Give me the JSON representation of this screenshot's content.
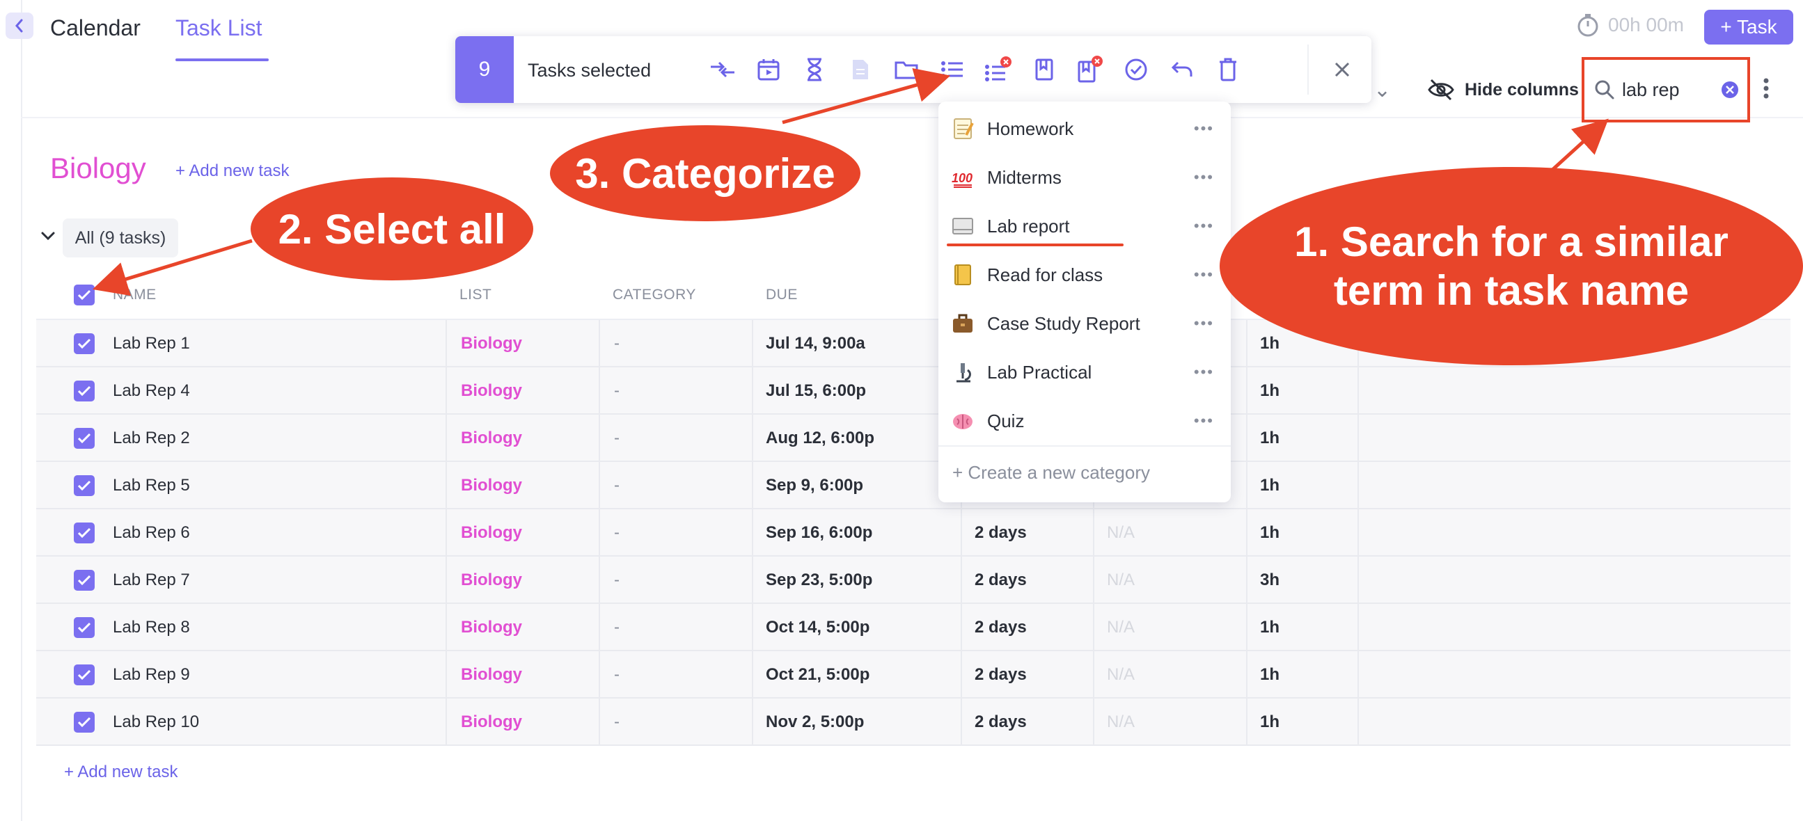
{
  "header": {
    "tabs": [
      {
        "label": "Calendar"
      },
      {
        "label": "Task List"
      }
    ],
    "timer": "00h 00m",
    "add_task_label": "+ Task",
    "view_chevron": "l",
    "hide_columns_label": "Hide columns",
    "search": {
      "value": "lab rep"
    }
  },
  "bulk_toolbar": {
    "count": "9",
    "label": "Tasks selected",
    "icons": [
      "merge-icon",
      "calendar-icon",
      "hourglass-icon",
      "document-icon",
      "folder-icon",
      "list-icon",
      "list-remove-icon",
      "book-icon",
      "book-remove-icon",
      "check-circle-icon",
      "undo-icon",
      "trash-icon",
      "close-icon"
    ]
  },
  "category_menu": {
    "items": [
      {
        "emoji": "memo",
        "label": "Homework"
      },
      {
        "emoji": "hundred-points",
        "label": "Midterms"
      },
      {
        "emoji": "notebook",
        "label": "Lab report"
      },
      {
        "emoji": "book",
        "label": "Read for class"
      },
      {
        "emoji": "briefcase",
        "label": "Case Study Report"
      },
      {
        "emoji": "microscope",
        "label": "Lab Practical"
      },
      {
        "emoji": "brain",
        "label": "Quiz"
      }
    ],
    "create_label": "+ Create a new category"
  },
  "section": {
    "title": "Biology",
    "add_new_label": "+ Add new task",
    "group_label": "All (9 tasks)"
  },
  "table": {
    "columns": [
      "NAME",
      "LIST",
      "CATEGORY",
      "DUE"
    ],
    "rows": [
      {
        "name": "Lab Rep 1",
        "list": "Biology",
        "category": "-",
        "due": "Jul 14, 9:00a",
        "estimate": "",
        "status": "",
        "hours": "1h"
      },
      {
        "name": "Lab Rep 4",
        "list": "Biology",
        "category": "-",
        "due": "Jul 15, 6:00p",
        "estimate": "",
        "status": "",
        "hours": "1h"
      },
      {
        "name": "Lab Rep 2",
        "list": "Biology",
        "category": "-",
        "due": "Aug 12, 6:00p",
        "estimate": "",
        "status": "",
        "hours": "1h"
      },
      {
        "name": "Lab Rep 5",
        "list": "Biology",
        "category": "-",
        "due": "Sep 9, 6:00p",
        "estimate": "",
        "status": "",
        "hours": "1h"
      },
      {
        "name": "Lab Rep 6",
        "list": "Biology",
        "category": "-",
        "due": "Sep 16, 6:00p",
        "estimate": "2 days",
        "status": "N/A",
        "hours": "1h"
      },
      {
        "name": "Lab Rep 7",
        "list": "Biology",
        "category": "-",
        "due": "Sep 23, 5:00p",
        "estimate": "2 days",
        "status": "N/A",
        "hours": "3h"
      },
      {
        "name": "Lab Rep 8",
        "list": "Biology",
        "category": "-",
        "due": "Oct 14, 5:00p",
        "estimate": "2 days",
        "status": "N/A",
        "hours": "1h"
      },
      {
        "name": "Lab Rep 9",
        "list": "Biology",
        "category": "-",
        "due": "Oct 21, 5:00p",
        "estimate": "2 days",
        "status": "N/A",
        "hours": "1h"
      },
      {
        "name": "Lab Rep 10",
        "list": "Biology",
        "category": "-",
        "due": "Nov 2, 5:00p",
        "estimate": "2 days",
        "status": "N/A",
        "hours": "1h"
      }
    ],
    "add_new_label": "+ Add new task"
  },
  "annotations": {
    "step1": "1. Search for a similar term in task name",
    "step2": "2. Select all",
    "step3": "3. Categorize"
  },
  "colors": {
    "accent": "#7b6ff0",
    "list_pink": "#e14fd2",
    "annotation_red": "#e8452a"
  }
}
